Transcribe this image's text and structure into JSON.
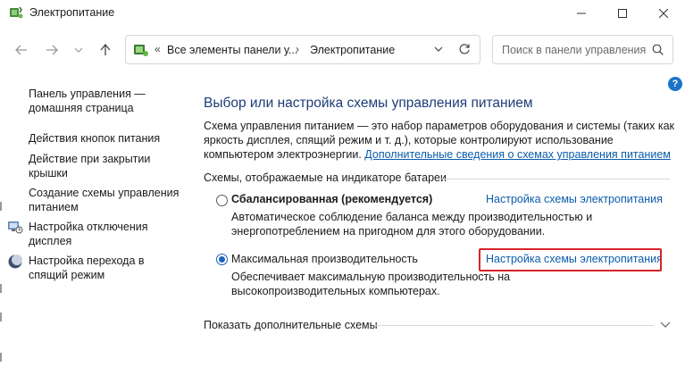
{
  "window": {
    "title": "Электропитание",
    "controls": [
      "minimize-icon",
      "maximize-icon",
      "close-icon"
    ]
  },
  "nav": {
    "breadcrumb": [
      {
        "label": "Все элементы панели у..."
      },
      {
        "label": "Электропитание"
      }
    ],
    "overflow": "«",
    "separator": "›",
    "search_placeholder": "Поиск в панели управления",
    "help": "?"
  },
  "sidebar": {
    "items": [
      {
        "label": "Панель управления — домашняя страница"
      },
      {
        "label": "Действия кнопок питания"
      },
      {
        "label": "Действие при закрытии крышки"
      },
      {
        "label": "Создание схемы управления питанием"
      },
      {
        "label": "Настройка отключения дисплея",
        "icon": "monitor-clock-icon"
      },
      {
        "label": "Настройка перехода в спящий режим",
        "icon": "moon-icon"
      }
    ]
  },
  "main": {
    "title": "Выбор или настройка схемы управления питанием",
    "description": "Схема управления питанием — это набор параметров оборудования и системы (таких как яркость дисплея, спящий режим и т. д.), которые контролируют использование компьютером электроэнергии. ",
    "description_link": "Дополнительные сведения о схемах управления питанием",
    "section_label": "Схемы, отображаемые на индикаторе батареи",
    "plans": [
      {
        "name": "Сбалансированная (рекомендуется)",
        "selected": false,
        "link": "Настройка схемы электропитания",
        "description": "Автоматическое соблюдение баланса между производительностью и энергопотреблением на пригодном для этого оборудовании."
      },
      {
        "name": "Максимальная производительность",
        "selected": true,
        "link": "Настройка схемы электропитания",
        "description": "Обеспечивает максимальную производительность на высокопроизводительных компьютерах."
      }
    ],
    "more_plans_label": "Показать дополнительные схемы"
  },
  "colors": {
    "title": "#1e3c78",
    "link": "#0b5cad",
    "highlight": "#d9232a",
    "radio_selected": "#1c62b9"
  }
}
